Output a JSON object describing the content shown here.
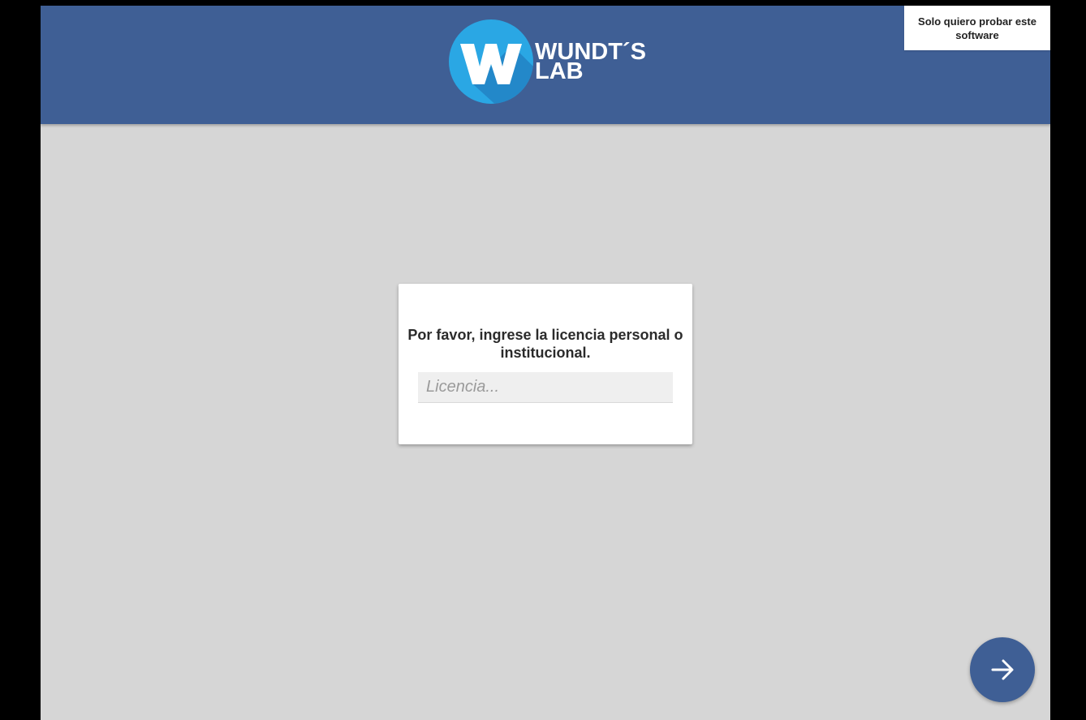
{
  "header": {
    "logo": {
      "icon": "wundts-lab-logo-icon",
      "line1": "WUNDT´S",
      "line2": "LAB"
    },
    "trial_button_label": "Solo quiero probar este software"
  },
  "license_card": {
    "prompt": "Por favor, ingrese la licencia personal o institucional.",
    "input_placeholder": "Licencia...",
    "input_value": ""
  },
  "next_button": {
    "icon": "arrow-right-icon"
  },
  "colors": {
    "header_background": "#3f5f95",
    "page_background": "#d6d6d6",
    "logo_circle": "#2aa7e4",
    "fab_background": "#3f5f95"
  }
}
